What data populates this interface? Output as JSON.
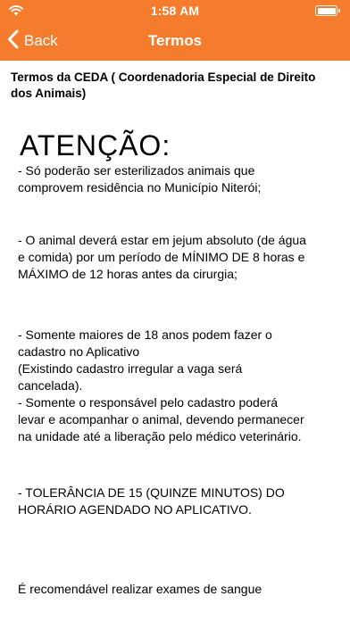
{
  "status_bar": {
    "time": "1:58 AM",
    "wifi_icon": "wifi-icon",
    "battery_icon": "battery-full-icon"
  },
  "nav": {
    "back_label": "Back",
    "back_icon": "chevron-left-icon",
    "title": "Termos",
    "color": "#f57c2c"
  },
  "content": {
    "header": "Termos da CEDA ( Coordenadoria Especial de Direito dos Animais)",
    "attention": "ATENÇÃO:",
    "paragraphs": [
      "- Só poderão ser esterilizados animais que\ncomprovem residência no Município Niterói;",
      "- O animal deverá estar em jejum absoluto (de água\ne comida) por um período de MÍNIMO DE 8 horas e\nMÁXIMO de 12 horas antes da cirurgia;",
      " - Somente maiores de 18 anos podem fazer o\ncadastro no Aplicativo\n(Existindo cadastro irregular a vaga será\ncancelada).\n- Somente o responsável pelo cadastro poderá\nlevar e acompanhar o animal, devendo permanecer\nna unidade até a liberação pelo médico veterinário.",
      " - TOLERÂNCIA DE 15 (QUINZE MINUTOS) DO\nHORÁRIO AGENDADO NO APLICATIVO.",
      "É recomendável realizar exames de sangue"
    ]
  }
}
